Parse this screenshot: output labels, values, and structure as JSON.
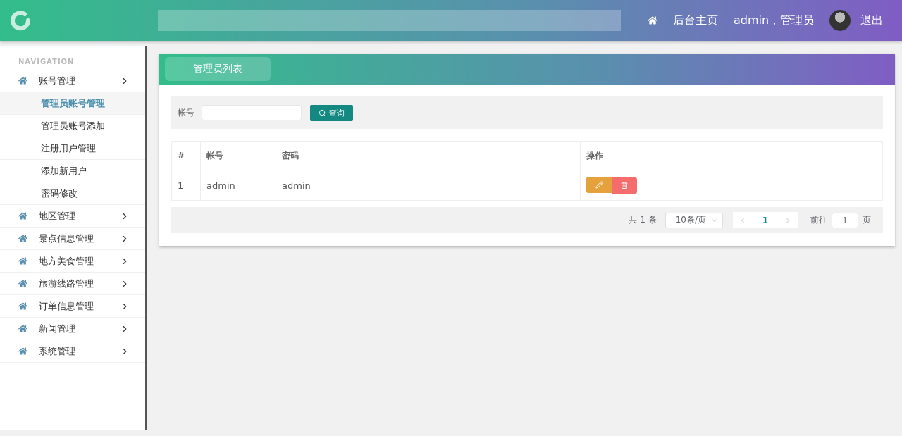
{
  "header": {
    "nav_links": [
      {
        "kind": "home-icon"
      },
      {
        "kind": "text",
        "label": "后台主页"
      },
      {
        "kind": "text",
        "label": "admin，管理员"
      },
      {
        "kind": "avatar"
      },
      {
        "kind": "text",
        "label": "退出"
      }
    ]
  },
  "sidebar": {
    "heading": "NAVIGATION",
    "items": [
      {
        "label": "账号管理",
        "children": [
          {
            "label": "管理员账号管理",
            "selected": true
          },
          {
            "label": "管理员账号添加",
            "selected": false
          },
          {
            "label": "注册用户管理",
            "selected": false
          },
          {
            "label": "添加新用户",
            "selected": false
          },
          {
            "label": "密码修改",
            "selected": false
          }
        ]
      },
      {
        "label": "地区管理"
      },
      {
        "label": "景点信息管理"
      },
      {
        "label": "地方美食管理"
      },
      {
        "label": "旅游线路管理"
      },
      {
        "label": "订单信息管理"
      },
      {
        "label": "新闻管理"
      },
      {
        "label": "系统管理"
      }
    ]
  },
  "card": {
    "title": "管理员列表",
    "search": {
      "label": "帐号",
      "button": "查询"
    },
    "table": {
      "columns": [
        "#",
        "帐号",
        "密码",
        "操作"
      ],
      "rows": [
        {
          "cells": [
            "1",
            "admin",
            "admin"
          ]
        }
      ]
    },
    "pagination": {
      "total": "共 1 条",
      "page_size": "10条/页",
      "pages": [
        {
          "label": "1",
          "selected": true
        }
      ],
      "goto_label": "前往",
      "goto_value": "1",
      "goto_suffix": "页"
    }
  }
}
